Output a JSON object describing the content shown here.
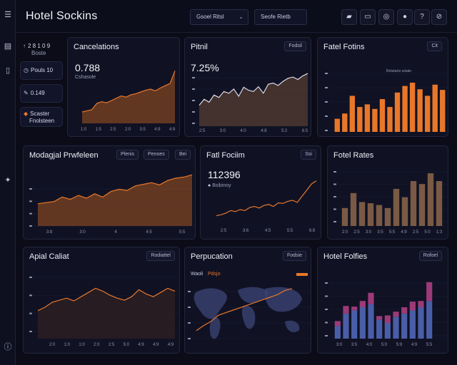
{
  "app": {
    "title": "Hotel Sockins"
  },
  "header": {
    "select1": "Gsoel Ritsl",
    "select2": "Seofe Rietb"
  },
  "sidebar_stats": [
    {
      "value": "2 8 1 0 9",
      "sub": "Boste",
      "icon": "arrow-up-icon"
    },
    {
      "value": "Pouls 10",
      "icon": "clock-icon"
    },
    {
      "value": "0.149",
      "icon": "pen-icon"
    },
    {
      "value": "Scaster",
      "sub": "Fnolsteen",
      "icon": "tag-icon"
    }
  ],
  "cards": {
    "cancellations": {
      "title": "Cancelations",
      "value": "0.788",
      "sub": "Cshasole",
      "ticks": [
        "1:0",
        "1:5",
        "2:5",
        "2:0",
        "3:5",
        "4:9",
        "4:9"
      ]
    },
    "pital": {
      "title": "Pitnil",
      "badge": "Fodsil",
      "value": "7.25%",
      "ticks": [
        "2:5",
        "3:0",
        "4:0",
        "4:8",
        "5:2",
        "6:5"
      ]
    },
    "fatel_folfins": {
      "title": "Fatel Fotins",
      "badge": "Cit",
      "legend": "Rotstarto sstato"
    },
    "medagel": {
      "title": "Modagjal Prwfeleen",
      "badge1": "Plenis",
      "badge2": "Penoes",
      "badge3": "Bei",
      "ticks": [
        "3:8",
        "3:0",
        "4",
        "4:5",
        "5:5"
      ]
    },
    "fatl_fociim": {
      "title": "Fatl Fociim",
      "badge": "Ssi",
      "value": "112396",
      "sub": "Bsibinoy",
      "ticks": [
        "2:5",
        "3:6",
        "4:5",
        "5:5",
        "6:8"
      ]
    },
    "fotel_rates": {
      "title": "Fotel Rates",
      "ticks": [
        "2:0",
        "2:5",
        "3:0",
        "3:5",
        "5:5",
        "4:9",
        "2:5",
        "5:0",
        "1:3"
      ]
    },
    "apial_caliat": {
      "title": "Apial Caliat",
      "badge": "Rodiattel",
      "ticks": [
        "2:0",
        "1:0",
        "1:0",
        "2:0",
        "2:5",
        "5:0",
        "4:9",
        "4:9",
        "4:9"
      ]
    },
    "perpucation": {
      "title": "Perpucation",
      "badge": "Fodsie",
      "legend1": "Waoli",
      "legend2": "Pdsjo"
    },
    "hotel_folfies": {
      "title": "Hotel Folfies",
      "badge": "Rofoel",
      "ticks": [
        "3:0",
        "3:5",
        "4:0",
        "5:0",
        "5:9",
        "4:9",
        "5:5"
      ]
    }
  },
  "colors": {
    "orange": "#e8772a",
    "orange_dim": "#a65520",
    "brown": "#7a5a44",
    "blue": "#4a5ea8",
    "magenta": "#9c3a78"
  },
  "chart_data": [
    {
      "type": "area",
      "title": "Cancelations",
      "values": [
        20,
        22,
        24,
        35,
        38,
        36,
        40,
        44,
        48,
        46,
        50,
        52,
        55,
        58,
        60,
        57,
        62,
        66,
        70,
        92
      ]
    },
    {
      "type": "line",
      "title": "Pitnil",
      "values": [
        35,
        45,
        40,
        52,
        48,
        58,
        55,
        62,
        50,
        65,
        60,
        58,
        66,
        55,
        70,
        72,
        68,
        75,
        80,
        82,
        78,
        84,
        88
      ]
    },
    {
      "type": "bar",
      "title": "Fatel Fotins",
      "values": [
        20,
        28,
        55,
        38,
        42,
        35,
        50,
        38,
        60,
        70,
        75,
        65,
        55,
        72,
        64
      ]
    },
    {
      "type": "area",
      "title": "Modagjal Prwfeleen",
      "values": [
        40,
        42,
        44,
        52,
        48,
        55,
        50,
        58,
        52,
        62,
        66,
        64,
        72,
        75,
        78,
        74,
        82,
        86,
        88,
        92
      ]
    },
    {
      "type": "line",
      "title": "Fatl Fociim",
      "values": [
        20,
        22,
        25,
        30,
        28,
        32,
        30,
        36,
        38,
        35,
        40,
        42,
        38,
        45,
        44,
        48,
        50,
        46,
        58,
        70,
        82,
        88
      ]
    },
    {
      "type": "bar",
      "title": "Fotel Rates",
      "values": [
        30,
        55,
        40,
        38,
        35,
        30,
        62,
        48,
        75,
        70,
        88,
        75
      ]
    },
    {
      "type": "area",
      "title": "Apial Caliat",
      "values": [
        40,
        45,
        52,
        55,
        58,
        54,
        60,
        66,
        72,
        68,
        62,
        58,
        55,
        60,
        70,
        64,
        60,
        66,
        72,
        68
      ]
    },
    {
      "type": "line",
      "title": "Perpucation",
      "values": [
        10,
        20,
        28,
        40,
        45,
        50,
        55,
        60,
        65,
        70,
        75,
        80,
        88,
        92
      ]
    },
    {
      "type": "bar",
      "title": "Hotel Folfies",
      "series": [
        {
          "values": [
            20,
            40,
            45,
            50,
            55,
            30,
            25,
            35,
            40,
            45,
            50,
            60
          ]
        },
        {
          "values": [
            8,
            12,
            6,
            10,
            18,
            6,
            12,
            8,
            10,
            14,
            10,
            30
          ]
        }
      ]
    }
  ]
}
